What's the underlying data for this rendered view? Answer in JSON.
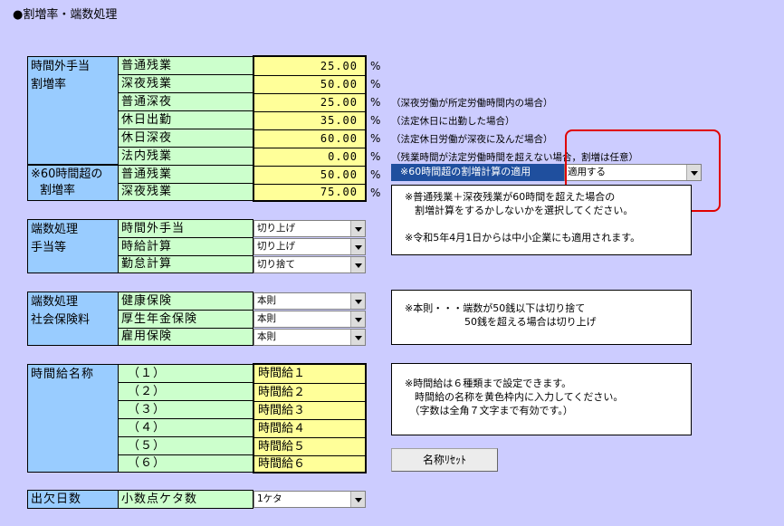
{
  "title": "●割増率・端数処理",
  "premium": {
    "label1": "時間外手当",
    "label2": "割増率",
    "rows": [
      {
        "name": "普通残業",
        "value": "25.00"
      },
      {
        "name": "深夜残業",
        "value": "50.00"
      },
      {
        "name": "普通深夜",
        "value": "25.00"
      },
      {
        "name": "休日出勤",
        "value": "35.00"
      },
      {
        "name": "休日深夜",
        "value": "60.00"
      },
      {
        "name": "法内残業",
        "value": "0.00"
      }
    ],
    "unit": "%"
  },
  "premium60": {
    "label1": "※60時間超の",
    "label2": "割増率",
    "rows": [
      {
        "name": "普通残業",
        "value": "50.00"
      },
      {
        "name": "深夜残業",
        "value": "75.00"
      }
    ]
  },
  "notes": {
    "late_night": "（深夜労働が所定労働時間内の場合）",
    "holiday": "（法定休日に出勤した場合）",
    "holiday_night": "（法定休日労働が深夜に及んだ場合）",
    "statutory": "（残業時間が法定労働時間を超えない場合，割増は任意）"
  },
  "over60": {
    "label": "※60時間超の割増計算の適用",
    "selected": "適用する",
    "info_lines": [
      "※普通残業＋深夜残業が60時間を超えた場合の",
      "　割増計算をするかしないかを選択してください。",
      "",
      "※令和5年4月1日からは中小企業にも適用されます。"
    ]
  },
  "rounding": {
    "label1": "端数処理",
    "label2": "手当等",
    "rows": [
      {
        "name": "時間外手当",
        "value": "切り上げ"
      },
      {
        "name": "時給計算",
        "value": "切り上げ"
      },
      {
        "name": "勤怠計算",
        "value": "切り捨て"
      }
    ]
  },
  "insurance": {
    "label1": "端数処理",
    "label2": "社会保険料",
    "rows": [
      {
        "name": "健康保険",
        "value": "本則"
      },
      {
        "name": "厚生年金保険",
        "value": "本則"
      },
      {
        "name": "雇用保険",
        "value": "本則"
      }
    ],
    "info_lines": [
      "※本則・・・端数が50銭以下は切り捨て",
      "　　　　　　50銭を超える場合は切り上げ"
    ]
  },
  "hourly": {
    "label": "時間給名称",
    "rows": [
      {
        "name": "（１）",
        "value": "時間給１"
      },
      {
        "name": "（２）",
        "value": "時間給２"
      },
      {
        "name": "（３）",
        "value": "時間給３"
      },
      {
        "name": "（４）",
        "value": "時間給４"
      },
      {
        "name": "（５）",
        "value": "時間給５"
      },
      {
        "name": "（６）",
        "value": "時間給６"
      }
    ],
    "info_lines": [
      "※時間給は６種類まで設定できます。",
      "　時間給の名称を黄色枠内に入力してください。",
      "　（字数は全角７文字まで有効です。）"
    ],
    "reset_button": "名称ﾘｾｯﾄ"
  },
  "attendance": {
    "label": "出欠日数",
    "name": "小数点ケタ数",
    "value": "1ケタ"
  }
}
